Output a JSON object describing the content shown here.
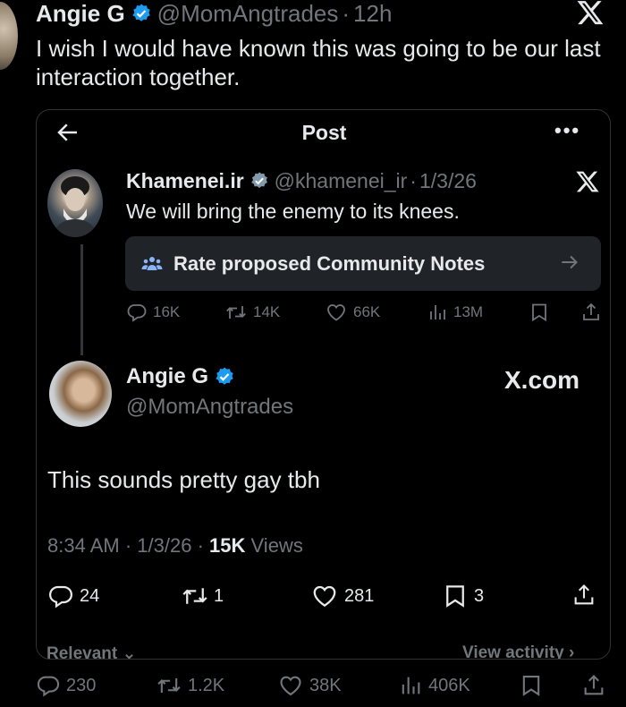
{
  "outer": {
    "name": "Angie G",
    "handle": "@MomAngtrades",
    "separator": "·",
    "time": "12h",
    "text": "I wish I would have known this was going to be our last interaction together."
  },
  "card": {
    "title": "Post",
    "more": "•••",
    "original": {
      "name": "Khamenei.ir",
      "handle": "@khamenei_ir",
      "separator": "·",
      "date": "1/3/26",
      "text": "We will bring the enemy to its knees.",
      "community_notes": "Rate proposed Community Notes",
      "stats": {
        "replies": "16K",
        "reposts": "14K",
        "likes": "66K",
        "views": "13M"
      }
    },
    "reply": {
      "name": "Angie G",
      "handle": "@MomAngtrades",
      "watermark": "X.com",
      "text": "This sounds pretty gay tbh",
      "time": "8:34 AM",
      "date": "1/3/26",
      "views_count": "15K",
      "views_label": "Views",
      "stats": {
        "replies": "24",
        "reposts": "1",
        "likes": "281",
        "bookmarks": "3"
      }
    },
    "relevant": "Relevant ⌄",
    "view_activity": "View activity ›"
  },
  "outer_stats": {
    "replies": "230",
    "reposts": "1.2K",
    "likes": "38K",
    "views": "406K"
  },
  "colors": {
    "background": "#000000",
    "text": "#e7e9ea",
    "muted": "#71767b",
    "verified": "#1d9bf0",
    "border": "#2f3336"
  },
  "icons": [
    "verified-badge-icon",
    "x-logo-icon",
    "back-arrow-icon",
    "people-icon",
    "arrow-right-icon",
    "reply-icon",
    "repost-icon",
    "like-icon",
    "views-icon",
    "bookmark-icon",
    "share-icon"
  ]
}
